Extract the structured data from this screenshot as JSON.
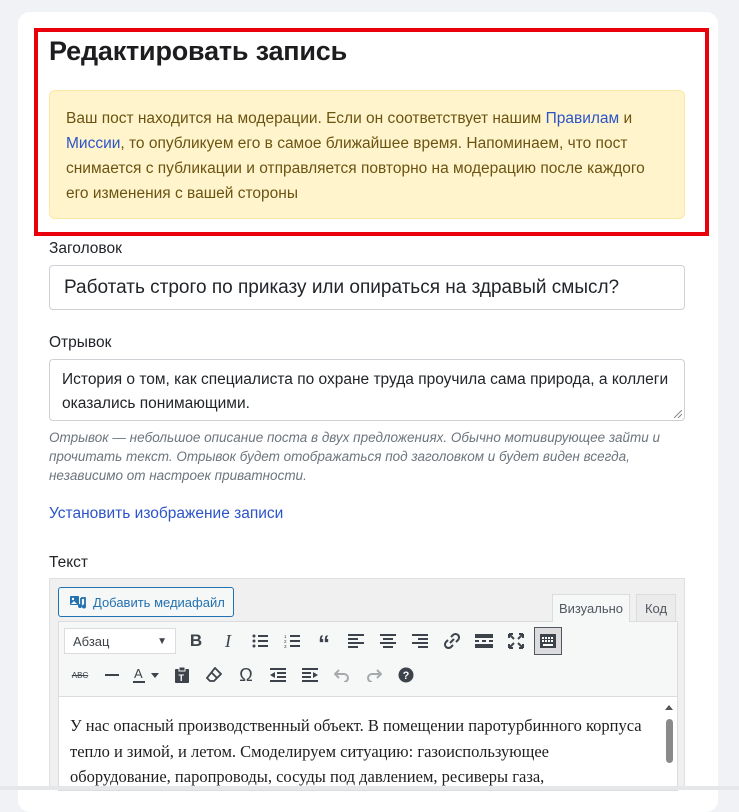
{
  "page": {
    "title": "Редактировать запись"
  },
  "moderation_alert": {
    "text_part1": "Ваш пост находится на модерации. Если он соответствует нашим ",
    "link_rules": "Правилам",
    "text_part2": " и ",
    "link_mission": "Миссии",
    "text_part3": ", то опубликуем его в самое ближайшее время. Напоминаем, что пост снимается с публикации и отправляется повторно на модерацию после каждого его изменения с вашей стороны"
  },
  "form": {
    "title_label": "Заголовок",
    "title_value": "Работать строго по приказу или опираться на здравый смысл?",
    "excerpt_label": "Отрывок",
    "excerpt_value": "История о том, как специалиста по охране труда проучила сама природа, а коллеги оказались понимающими.",
    "excerpt_hint": "Отрывок — небольшое описание поста в двух предложениях. Обычно мотивирующее зайти и прочитать текст. Отрывок будет отображаться под заголовком и будет виден всегда, независимо от настроек приватности.",
    "featured_image_link": "Установить изображение записи",
    "text_label": "Текст"
  },
  "editor": {
    "add_media_label": "Добавить медиафайл",
    "tabs": [
      "Визуально",
      "Код"
    ],
    "active_tab": "Визуально",
    "format_select_value": "Абзац",
    "toolbar_row1": [
      "bold-icon",
      "italic-icon",
      "bullet-list-icon",
      "numbered-list-icon",
      "blockquote-icon",
      "align-left-icon",
      "align-center-icon",
      "align-right-icon",
      "link-icon",
      "read-more-icon",
      "fullscreen-icon",
      "toolbar-toggle-icon"
    ],
    "toolbar_row2": [
      "strikethrough-icon",
      "horizontal-line-icon",
      "text-color-icon",
      "paste-text-icon",
      "clear-formatting-icon",
      "special-character-icon",
      "outdent-icon",
      "indent-icon",
      "undo-icon",
      "redo-icon",
      "help-icon"
    ],
    "content": "У нас опасный производственный объект. В помещении паротурбинного корпуса тепло и зимой, и летом. Смоделируем ситуацию: газоиспользующее оборудование, паропроводы, сосуды под давлением, ресиверы газа,"
  },
  "colors": {
    "highlight_border": "#e8000b",
    "alert_bg": "#fff4cc",
    "link": "#2c54c9",
    "media_button": "#2271b1"
  }
}
